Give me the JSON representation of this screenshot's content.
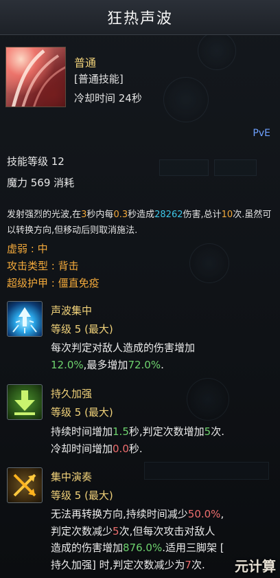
{
  "skill": {
    "title": "狂热声波",
    "type": "普通",
    "subtype": "[普通技能]",
    "cooldown": "冷却时间 24秒",
    "mode_tag": "PvE",
    "level": "技能等级 12",
    "mana": "魔力 569 消耗"
  },
  "description": {
    "p1": "发射强烈的光波,在",
    "v1": "3",
    "p2": "秒内每",
    "v2": "0.3",
    "p3": "秒造成",
    "v3": "28262",
    "p4": "伤害,总计",
    "v4": "10",
    "p5": "次.虽然可以转换方向,但移动后则取消施法."
  },
  "attributes": {
    "weak_point": "虚弱 : 中",
    "attack_type": "攻击类型 : 背击",
    "super_armor": "超级护甲 : 僵直免疫"
  },
  "tripods": [
    {
      "icon": "sonic-burst-icon",
      "name": "声波集中",
      "level": "等级 5 (最大)",
      "d1": "每次判定对敌人造成的伤害增加",
      "d2": "12.0%",
      "d3": ",最多增加",
      "d4": "72.0%",
      "d5": "."
    },
    {
      "icon": "down-arrow-icon",
      "name": "持久加强",
      "level": "等级 5 (最大)",
      "d1": "持续时间增加",
      "d2": "1.5",
      "d3": "秒,判定次数增加",
      "d4": "5",
      "d5": "次.",
      "d6": "冷却时间增加",
      "d7": "0.0",
      "d8": "秒."
    },
    {
      "icon": "crossed-arrows-icon",
      "name": "集中演奏",
      "level": "等级 5 (最大)",
      "d1": "无法再转换方向,持续时间减少",
      "d2": "50.0%",
      "d3": ",",
      "d4": "判定次数减少",
      "d5": "5",
      "d6": "次,但每次攻击对敌人",
      "d7": "造成的伤害增加",
      "d8": "876.0%",
      "d9": ".适用三脚架 [",
      "d10": "持久加强] 时,判定次数减少为",
      "d11": "7",
      "d12": "次."
    }
  ],
  "watermark": "元计算",
  "colors": {
    "gold": "#f1d27a",
    "orange": "#f2a93b",
    "cyan": "#3ec7e8",
    "green": "#6ed36e",
    "red": "#ee6e6e",
    "pve_blue": "#6ea1ff"
  }
}
